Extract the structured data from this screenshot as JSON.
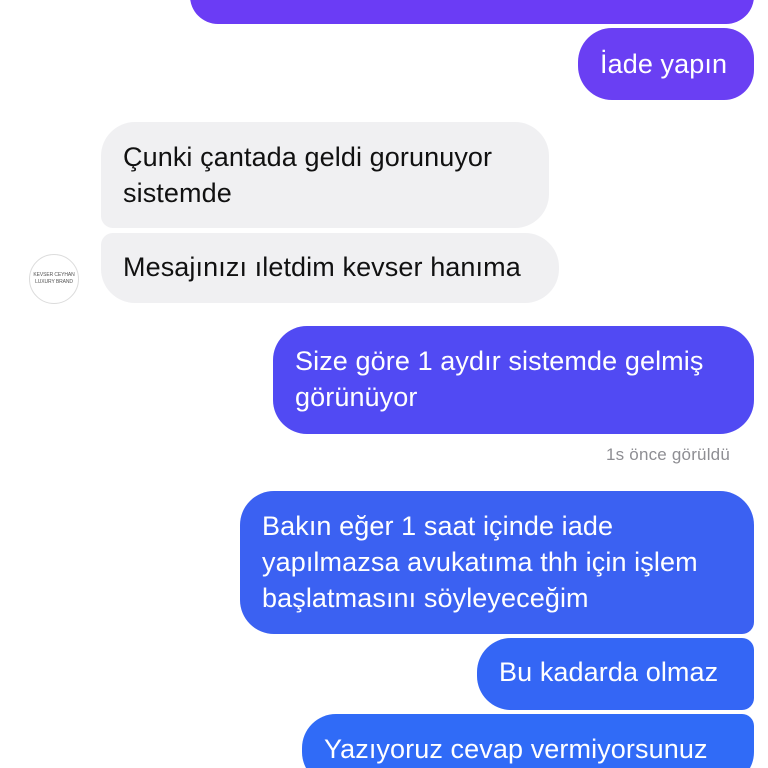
{
  "contact": {
    "avatar_line1": "KEVSER CEYHAN",
    "avatar_line2": "LUXURY BRAND"
  },
  "messages": [
    {
      "from": "me",
      "text": ""
    },
    {
      "from": "me",
      "text": "İade yapın"
    },
    {
      "from": "them",
      "text": "Çunki çantada geldi gorunuyor\nsistemde"
    },
    {
      "from": "them",
      "text": "Mesajınızı ıletdim kevser hanıma"
    },
    {
      "from": "me",
      "text": "Size göre 1 aydır sistemde gelmiş\ngörünüyor"
    },
    {
      "from": "me",
      "text": "Bakın eğer 1 saat içinde iade\nyapılmazsa avukatıma thh için işlem\nbaşlatmasını söyleyeceğim"
    },
    {
      "from": "me",
      "text": "Bu kadarda olmaz"
    },
    {
      "from": "me",
      "text": "Yazıyoruz cevap vermiyorsunuz"
    }
  ],
  "status": {
    "seen_text": "1s önce görüldü"
  },
  "colors": {
    "outgoing_top": "#6b3cf5",
    "outgoing_bottom": "#306bf7",
    "incoming_bg": "#f0f0f2",
    "seen_text": "#8e8e93"
  }
}
